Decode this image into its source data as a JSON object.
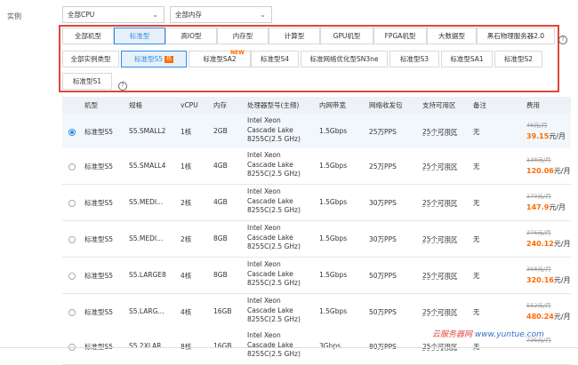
{
  "filters": {
    "label": "实例",
    "cpu_select": "全部CPU",
    "mem_select": "全部内存"
  },
  "families": [
    "全部机型",
    "标准型",
    "高IO型",
    "内存型",
    "计算型",
    "GPU机型",
    "FPGA机型",
    "大数据型",
    "黑石物理服务器2.0"
  ],
  "types": [
    "全部实例类型",
    "标准型S5",
    "标准型SA2",
    "标准型S4",
    "标准网络优化型SN3ne",
    "标准型S3",
    "标准型SA1",
    "标准型S2",
    "标准型S1"
  ],
  "badges": {
    "hot": "热",
    "new": "NEW"
  },
  "table": {
    "headers": [
      "机型",
      "规格",
      "vCPU",
      "内存",
      "处理器型号(主频)",
      "内网带宽",
      "网络收发包",
      "支持可用区",
      "备注",
      "费用"
    ],
    "rows": [
      {
        "model": "标准型S5",
        "spec": "S5.SMALL2",
        "vcpu": "1核",
        "mem": "2GB",
        "proc": [
          "Intel Xeon",
          "Cascade Lake",
          "8255C(2.5 GHz)"
        ],
        "bw": "1.5Gbps",
        "pps": "25万PPS",
        "az": "25个可用区",
        "note": "无",
        "old": "46元/月",
        "price": "39.15",
        "unit": "元/月"
      },
      {
        "model": "标准型S5",
        "spec": "S5.SMALL4",
        "vcpu": "1核",
        "mem": "4GB",
        "proc": [
          "Intel Xeon",
          "Cascade Lake",
          "8255C(2.5 GHz)"
        ],
        "bw": "1.5Gbps",
        "pps": "25万PPS",
        "az": "25个可用区",
        "note": "无",
        "old": "138元/月",
        "price": "120.06",
        "unit": "元/月"
      },
      {
        "model": "标准型S5",
        "spec": "S5.MEDI...",
        "vcpu": "2核",
        "mem": "4GB",
        "proc": [
          "Intel Xeon",
          "Cascade Lake",
          "8255C(2.5 GHz)"
        ],
        "bw": "1.5Gbps",
        "pps": "30万PPS",
        "az": "25个可用区",
        "note": "无",
        "old": "170元/月",
        "price": "147.9",
        "unit": "元/月"
      },
      {
        "model": "标准型S5",
        "spec": "S5.MEDI...",
        "vcpu": "2核",
        "mem": "8GB",
        "proc": [
          "Intel Xeon",
          "Cascade Lake",
          "8255C(2.5 GHz)"
        ],
        "bw": "1.5Gbps",
        "pps": "30万PPS",
        "az": "25个可用区",
        "note": "无",
        "old": "276元/月",
        "price": "240.12",
        "unit": "元/月"
      },
      {
        "model": "标准型S5",
        "spec": "S5.LARGE8",
        "vcpu": "4核",
        "mem": "8GB",
        "proc": [
          "Intel Xeon",
          "Cascade Lake",
          "8255C(2.5 GHz)"
        ],
        "bw": "1.5Gbps",
        "pps": "50万PPS",
        "az": "25个可用区",
        "note": "无",
        "old": "368元/月",
        "price": "320.16",
        "unit": "元/月"
      },
      {
        "model": "标准型S5",
        "spec": "S5.LARG...",
        "vcpu": "4核",
        "mem": "16GB",
        "proc": [
          "Intel Xeon",
          "Cascade Lake",
          "8255C(2.5 GHz)"
        ],
        "bw": "1.5Gbps",
        "pps": "50万PPS",
        "az": "25个可用区",
        "note": "无",
        "old": "552元/月",
        "price": "480.24",
        "unit": "元/月"
      },
      {
        "model": "标准型S5",
        "spec": "S5.2XLAR...",
        "vcpu": "8核",
        "mem": "16GB",
        "proc": [
          "Intel Xeon",
          "Cascade Lake",
          "8255C(2.5 GHz)"
        ],
        "bw": "3Gbps",
        "pps": "80万PPS",
        "az": "25个可用区",
        "note": "无",
        "old": "736元/月",
        "price": "",
        "unit": ""
      }
    ]
  },
  "watermark": {
    "cn": "云服务器网",
    "url": "www.yuntue.com"
  }
}
